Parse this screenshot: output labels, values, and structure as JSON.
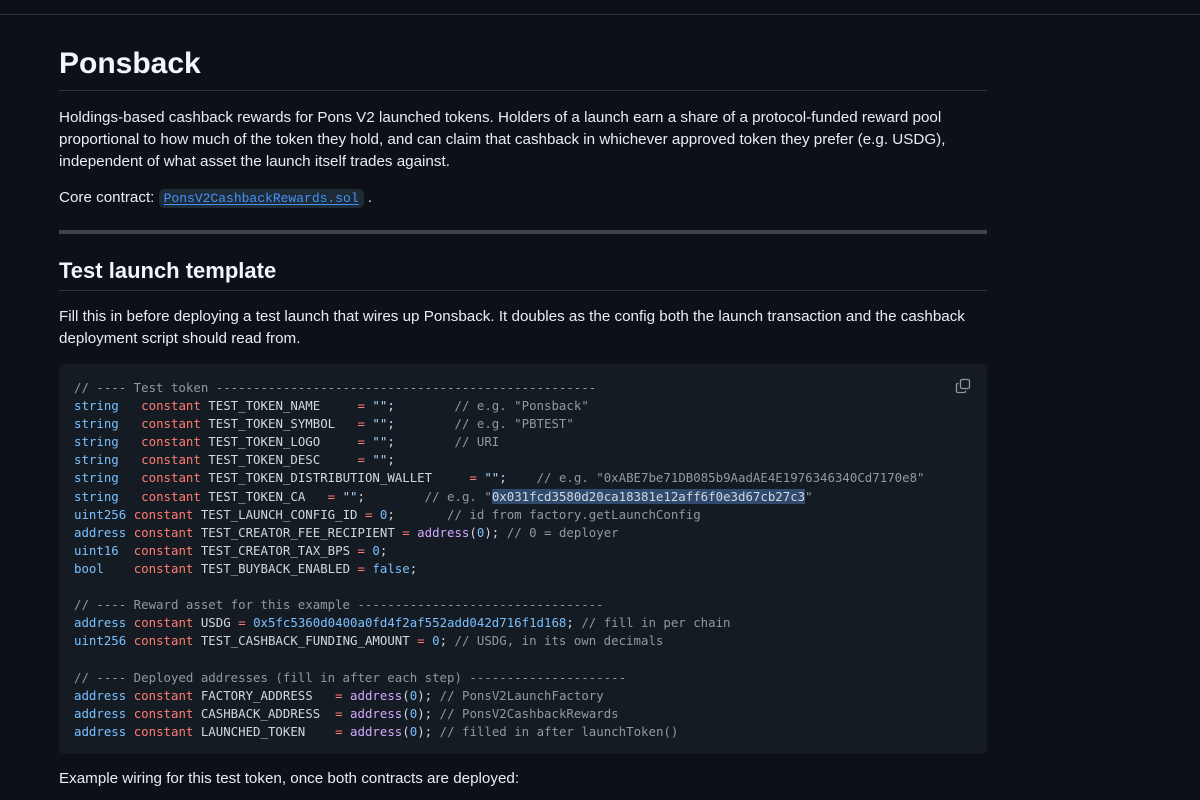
{
  "page": {
    "title": "Ponsback",
    "intro": "Holdings-based cashback rewards for Pons V2 launched tokens. Holders of a launch earn a share of a protocol-funded reward pool proportional to how much of the token they hold, and can claim that cashback in whichever approved token they prefer (e.g. USDG), independent of what asset the launch itself trades against.",
    "core_prefix": "Core contract: ",
    "core_link": "PonsV2CashbackRewards.sol",
    "core_suffix": ".",
    "section_title": "Test launch template",
    "section_intro": "Fill this in before deploying a test launch that wires up Ponsback. It doubles as the config both the launch transaction and the cashback deployment script should read from.",
    "footer_text": "Example wiring for this test token, once both contracts are deployed:"
  },
  "code": {
    "copy_icon": "copy-icon",
    "lines": [
      [
        [
          "cm",
          "// ---- Test token ---------------------------------------------------"
        ]
      ],
      [
        [
          "ty",
          "string"
        ],
        [
          "id",
          "   "
        ],
        [
          "kw",
          "constant"
        ],
        [
          "id",
          " TEST_TOKEN_NAME     "
        ],
        [
          "op",
          "="
        ],
        [
          "st",
          " \"\""
        ],
        [
          "id",
          ";        "
        ],
        [
          "cm",
          "// e.g. \"Ponsback\""
        ]
      ],
      [
        [
          "ty",
          "string"
        ],
        [
          "id",
          "   "
        ],
        [
          "kw",
          "constant"
        ],
        [
          "id",
          " TEST_TOKEN_SYMBOL   "
        ],
        [
          "op",
          "="
        ],
        [
          "st",
          " \"\""
        ],
        [
          "id",
          ";        "
        ],
        [
          "cm",
          "// e.g. \"PBTEST\""
        ]
      ],
      [
        [
          "ty",
          "string"
        ],
        [
          "id",
          "   "
        ],
        [
          "kw",
          "constant"
        ],
        [
          "id",
          " TEST_TOKEN_LOGO     "
        ],
        [
          "op",
          "="
        ],
        [
          "st",
          " \"\""
        ],
        [
          "id",
          ";        "
        ],
        [
          "cm",
          "// URI"
        ]
      ],
      [
        [
          "ty",
          "string"
        ],
        [
          "id",
          "   "
        ],
        [
          "kw",
          "constant"
        ],
        [
          "id",
          " TEST_TOKEN_DESC     "
        ],
        [
          "op",
          "="
        ],
        [
          "st",
          " \"\""
        ],
        [
          "id",
          ";"
        ]
      ],
      [
        [
          "ty",
          "string"
        ],
        [
          "id",
          "   "
        ],
        [
          "kw",
          "constant"
        ],
        [
          "id",
          " TEST_TOKEN_DISTRIBUTION_WALLET     "
        ],
        [
          "op",
          "="
        ],
        [
          "st",
          " \"\""
        ],
        [
          "id",
          ";    "
        ],
        [
          "cm",
          "// e.g. \"0xABE7be71DB085b9AadAE4E1976346340Cd7170e8\""
        ]
      ],
      [
        [
          "ty",
          "string"
        ],
        [
          "id",
          "   "
        ],
        [
          "kw",
          "constant"
        ],
        [
          "id",
          " TEST_TOKEN_CA   "
        ],
        [
          "op",
          "="
        ],
        [
          "st",
          " \"\""
        ],
        [
          "id",
          ";        "
        ],
        [
          "cm",
          "// e.g. \""
        ],
        [
          "sel",
          "0x031fcd3580d20ca18381e12aff6f0e3d67cb27c3"
        ],
        [
          "cm",
          "\""
        ]
      ],
      [
        [
          "ty",
          "uint256"
        ],
        [
          "id",
          " "
        ],
        [
          "kw",
          "constant"
        ],
        [
          "id",
          " TEST_LAUNCH_CONFIG_ID "
        ],
        [
          "op",
          "="
        ],
        [
          "nu",
          " 0"
        ],
        [
          "id",
          ";       "
        ],
        [
          "cm",
          "// id from factory.getLaunchConfig"
        ]
      ],
      [
        [
          "ty",
          "address"
        ],
        [
          "id",
          " "
        ],
        [
          "kw",
          "constant"
        ],
        [
          "id",
          " TEST_CREATOR_FEE_RECIPIENT "
        ],
        [
          "op",
          "="
        ],
        [
          "fn",
          " address"
        ],
        [
          "id",
          "("
        ],
        [
          "nu",
          "0"
        ],
        [
          "id",
          "); "
        ],
        [
          "cm",
          "// 0 = deployer"
        ]
      ],
      [
        [
          "ty",
          "uint16"
        ],
        [
          "id",
          "  "
        ],
        [
          "kw",
          "constant"
        ],
        [
          "id",
          " TEST_CREATOR_TAX_BPS "
        ],
        [
          "op",
          "="
        ],
        [
          "nu",
          " 0"
        ],
        [
          "id",
          ";"
        ]
      ],
      [
        [
          "ty",
          "bool"
        ],
        [
          "id",
          "    "
        ],
        [
          "kw",
          "constant"
        ],
        [
          "id",
          " TEST_BUYBACK_ENABLED "
        ],
        [
          "op",
          "="
        ],
        [
          "nu",
          " false"
        ],
        [
          "id",
          ";"
        ]
      ],
      [
        [
          "id",
          " "
        ]
      ],
      [
        [
          "cm",
          "// ---- Reward asset for this example ---------------------------------"
        ]
      ],
      [
        [
          "ty",
          "address"
        ],
        [
          "id",
          " "
        ],
        [
          "kw",
          "constant"
        ],
        [
          "id",
          " USDG "
        ],
        [
          "op",
          "="
        ],
        [
          "nu",
          " 0x5fc5360d0400a0fd4f2af552add042d716f1d168"
        ],
        [
          "id",
          "; "
        ],
        [
          "cm",
          "// fill in per chain"
        ]
      ],
      [
        [
          "ty",
          "uint256"
        ],
        [
          "id",
          " "
        ],
        [
          "kw",
          "constant"
        ],
        [
          "id",
          " TEST_CASHBACK_FUNDING_AMOUNT "
        ],
        [
          "op",
          "="
        ],
        [
          "nu",
          " 0"
        ],
        [
          "id",
          "; "
        ],
        [
          "cm",
          "// USDG, in its own decimals"
        ]
      ],
      [
        [
          "id",
          " "
        ]
      ],
      [
        [
          "cm",
          "// ---- Deployed addresses (fill in after each step) ---------------------"
        ]
      ],
      [
        [
          "ty",
          "address"
        ],
        [
          "id",
          " "
        ],
        [
          "kw",
          "constant"
        ],
        [
          "id",
          " FACTORY_ADDRESS   "
        ],
        [
          "op",
          "="
        ],
        [
          "fn",
          " address"
        ],
        [
          "id",
          "("
        ],
        [
          "nu",
          "0"
        ],
        [
          "id",
          "); "
        ],
        [
          "cm",
          "// PonsV2LaunchFactory"
        ]
      ],
      [
        [
          "ty",
          "address"
        ],
        [
          "id",
          " "
        ],
        [
          "kw",
          "constant"
        ],
        [
          "id",
          " CASHBACK_ADDRESS  "
        ],
        [
          "op",
          "="
        ],
        [
          "fn",
          " address"
        ],
        [
          "id",
          "("
        ],
        [
          "nu",
          "0"
        ],
        [
          "id",
          "); "
        ],
        [
          "cm",
          "// PonsV2CashbackRewards"
        ]
      ],
      [
        [
          "ty",
          "address"
        ],
        [
          "id",
          " "
        ],
        [
          "kw",
          "constant"
        ],
        [
          "id",
          " LAUNCHED_TOKEN    "
        ],
        [
          "op",
          "="
        ],
        [
          "fn",
          " address"
        ],
        [
          "id",
          "("
        ],
        [
          "nu",
          "0"
        ],
        [
          "id",
          "); "
        ],
        [
          "cm",
          "// filled in after launchToken()"
        ]
      ]
    ]
  }
}
